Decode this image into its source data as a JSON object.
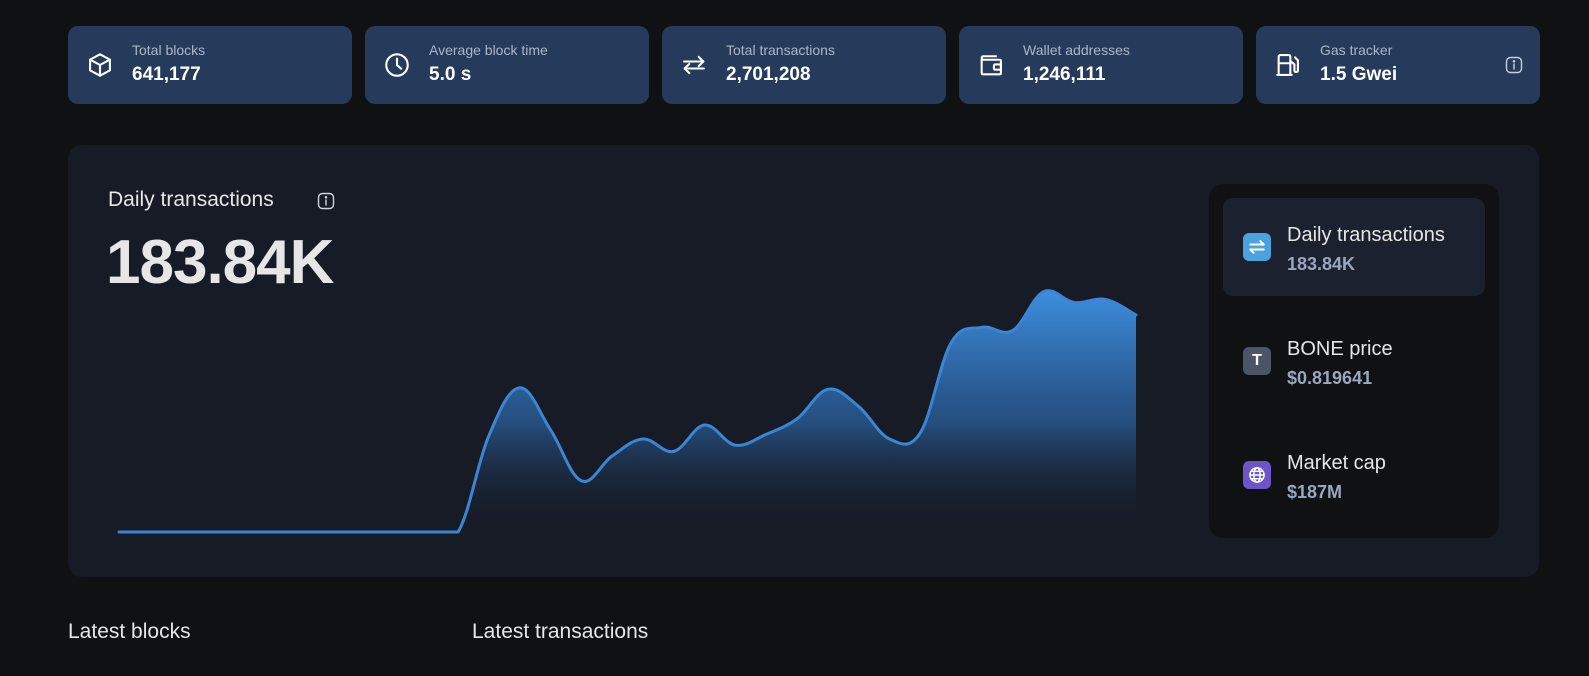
{
  "stats": [
    {
      "label": "Total blocks",
      "value": "641,177",
      "icon": "cube-icon"
    },
    {
      "label": "Average block time",
      "value": "5.0 s",
      "icon": "clock-icon"
    },
    {
      "label": "Total transactions",
      "value": "2,701,208",
      "icon": "transfer-arrows-icon"
    },
    {
      "label": "Wallet addresses",
      "value": "1,246,111",
      "icon": "wallet-icon"
    },
    {
      "label": "Gas tracker",
      "value": "1.5 Gwei",
      "icon": "gas-pump-icon"
    }
  ],
  "chart": {
    "title": "Daily transactions",
    "current_value": "183.84K",
    "line_color": "#3a86d4"
  },
  "chart_data": {
    "type": "area",
    "title": "Daily transactions",
    "xlabel": "",
    "ylabel": "",
    "grid": false,
    "series": [
      {
        "values": [
          0,
          0,
          0,
          0,
          0,
          0,
          0,
          0,
          0,
          0,
          0,
          0,
          62,
          93,
          66,
          33,
          49,
          60,
          52,
          69,
          56,
          63,
          73,
          92,
          81,
          60,
          64,
          122,
          132,
          130,
          155,
          148,
          150,
          140
        ]
      }
    ]
  },
  "side_metrics": [
    {
      "label": "Daily transactions",
      "value": "183.84K",
      "icon": "transfer-arrows-icon",
      "color": "#4aa3df",
      "active": true
    },
    {
      "label": "BONE price",
      "value": "$0.819641",
      "icon": "token-t-icon",
      "glyph": "T",
      "color": "#4b5567",
      "active": false
    },
    {
      "label": "Market cap",
      "value": "$187M",
      "icon": "globe-icon",
      "color": "#6b55c9",
      "active": false
    }
  ],
  "sections": {
    "latest_blocks": "Latest blocks",
    "latest_transactions": "Latest transactions"
  }
}
